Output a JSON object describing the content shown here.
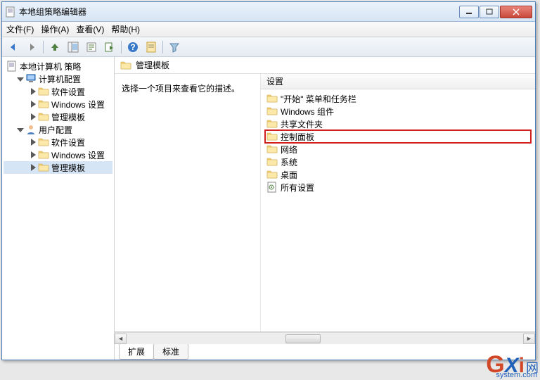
{
  "window": {
    "title": "本地组策略编辑器"
  },
  "menubar": {
    "file": "文件(F)",
    "action": "操作(A)",
    "view": "查看(V)",
    "help": "帮助(H)"
  },
  "tree": {
    "root": "本地计算机 策略",
    "computer": "计算机配置",
    "computer_children": [
      "软件设置",
      "Windows 设置",
      "管理模板"
    ],
    "user": "用户配置",
    "user_children": [
      "软件设置",
      "Windows 设置",
      "管理模板"
    ]
  },
  "breadcrumb": "管理模板",
  "desc_hint": "选择一个项目来查看它的描述。",
  "list": {
    "header_setting": "设置",
    "items": [
      {
        "label": "\"开始\" 菜单和任务栏",
        "type": "folder"
      },
      {
        "label": "Windows 组件",
        "type": "folder"
      },
      {
        "label": "共享文件夹",
        "type": "folder"
      },
      {
        "label": "控制面板",
        "type": "folder",
        "highlighted": true
      },
      {
        "label": "网络",
        "type": "folder"
      },
      {
        "label": "系统",
        "type": "folder"
      },
      {
        "label": "桌面",
        "type": "folder"
      },
      {
        "label": "所有设置",
        "type": "settings"
      }
    ]
  },
  "tabs": {
    "extended": "扩展",
    "standard": "标准"
  },
  "watermark": {
    "brand": "GXi",
    "cn": "网",
    "domain": "system.com"
  }
}
